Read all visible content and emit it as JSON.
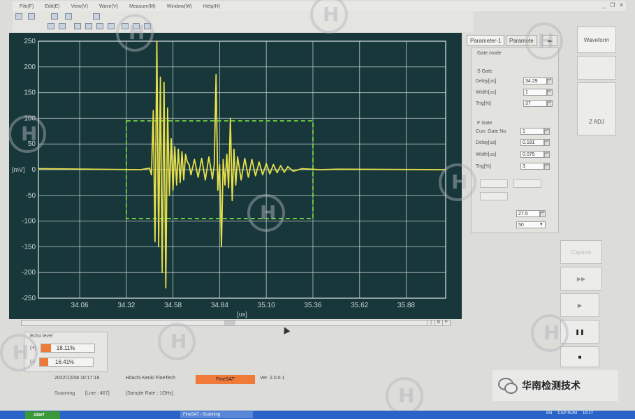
{
  "menu": [
    "File(F)",
    "Edit(E)",
    "View(V)",
    "Wave(V)",
    "Measure(M)",
    "Window(W)",
    "Help(H)"
  ],
  "plot": {
    "y_unit": "[mV]",
    "x_unit": "[us]",
    "y_ticks": [
      "250",
      "200",
      "150",
      "100",
      "50",
      "0",
      "-50",
      "-100",
      "-150",
      "-200",
      "-250"
    ],
    "x_ticks": [
      "34.06",
      "34.32",
      "34.58",
      "34.84",
      "35.10",
      "35.36",
      "35.62",
      "35.88"
    ],
    "trace_color": "#e8e04a",
    "gate_color": "#6fd13a"
  },
  "chart_data": {
    "type": "line",
    "title": "",
    "xlabel": "[us]",
    "ylabel": "[mV]",
    "xlim": [
      33.83,
      36.1
    ],
    "ylim": [
      -250,
      250
    ],
    "x_ticks": [
      34.06,
      34.32,
      34.58,
      34.84,
      35.1,
      35.36,
      35.62,
      35.88
    ],
    "y_ticks": [
      250,
      200,
      150,
      100,
      50,
      0,
      -50,
      -100,
      -150,
      -200,
      -250
    ],
    "grid": true,
    "gate": {
      "x_start": 34.32,
      "x_end": 35.36,
      "y_top": 95,
      "y_bottom": -95
    },
    "series": [
      {
        "x": [
          33.83,
          34.4,
          34.45,
          34.46,
          34.47,
          34.48,
          34.49,
          34.5,
          34.51,
          34.52,
          34.53,
          34.54,
          34.55,
          34.56,
          34.57,
          34.58,
          34.59,
          34.6,
          34.61,
          34.62,
          34.63,
          34.64,
          34.65,
          34.66,
          34.67,
          34.68,
          34.69,
          34.7,
          34.72,
          34.74,
          34.76,
          34.78,
          34.8,
          34.81,
          34.82,
          34.83,
          34.84,
          34.85,
          34.86,
          34.87,
          34.88,
          34.89,
          34.9,
          34.91,
          34.92,
          34.93,
          34.94,
          34.96,
          34.98,
          35.0,
          35.02,
          35.04,
          35.06,
          35.08,
          35.1,
          35.12,
          35.14,
          35.16,
          35.18,
          35.2,
          35.22,
          35.25,
          35.3,
          35.4,
          35.5,
          36.1
        ],
        "y": [
          2,
          0,
          3,
          -10,
          115,
          -140,
          250,
          -150,
          180,
          -200,
          170,
          -230,
          120,
          -50,
          60,
          -40,
          45,
          -30,
          40,
          -25,
          35,
          -20,
          30,
          15,
          10,
          -10,
          5,
          20,
          -15,
          22,
          -20,
          25,
          -18,
          10,
          185,
          -40,
          10,
          -150,
          20,
          -30,
          30,
          -35,
          100,
          -60,
          40,
          -30,
          25,
          -20,
          22,
          -15,
          20,
          -12,
          15,
          -10,
          12,
          -8,
          10,
          -6,
          8,
          -5,
          6,
          -3,
          2,
          0,
          1,
          0
        ]
      }
    ]
  },
  "scroll_buttons": [
    "|",
    "B",
    "F"
  ],
  "echo": {
    "title": "Echo level",
    "rows": [
      {
        "label": "(+)",
        "value": "18.11%",
        "level": 18.11
      },
      {
        "label": "(-)",
        "value": "16.41%",
        "level": 16.41
      }
    ]
  },
  "status": {
    "datetime": "2022/12/08  10:17:18",
    "company": "Hitachi Kenki FineTech",
    "app": "FineSAT",
    "version": "Ver. 2.0.0.1",
    "scanning": "Scanning",
    "line": "[Line : 467]",
    "sample_rate": "[Sample Rate : 1GHz]"
  },
  "tabs": {
    "param1": "Parameter-1",
    "param2": "Paramete"
  },
  "params": {
    "gate_mode": "Gate mode",
    "s_gate": "S Gate",
    "delay_label": "Delay[us]",
    "delay_val": "34.29",
    "width_label": "Width[us]",
    "width_val": "1",
    "trig_label": "Trig[%]",
    "trig_val": "37",
    "f_gate": "F Gate",
    "cur_gate_label": "Curr. Gate No.",
    "cur_gate_val": "1",
    "f_delay_label": "Delay[us]",
    "f_delay_val": "0.181",
    "f_width_label": "Width[us]",
    "f_width_val": "0.075",
    "f_trig_label": "Trig[%]",
    "f_trig_val": "3",
    "val_a": "27.5",
    "val_b": "50"
  },
  "right_buttons": {
    "waveform": "Waveform",
    "zadj": "Z ADJ",
    "capture": "Capture",
    "ff": "▶▶",
    "play": "▶",
    "pause": "❚❚",
    "stop": "■"
  },
  "wechat": "华南检测技术",
  "taskbar": {
    "start": "start",
    "app_item": "FineSAT - Scanning",
    "lang": "EN",
    "time": "10:17",
    "caps": "CAP  NUM"
  }
}
